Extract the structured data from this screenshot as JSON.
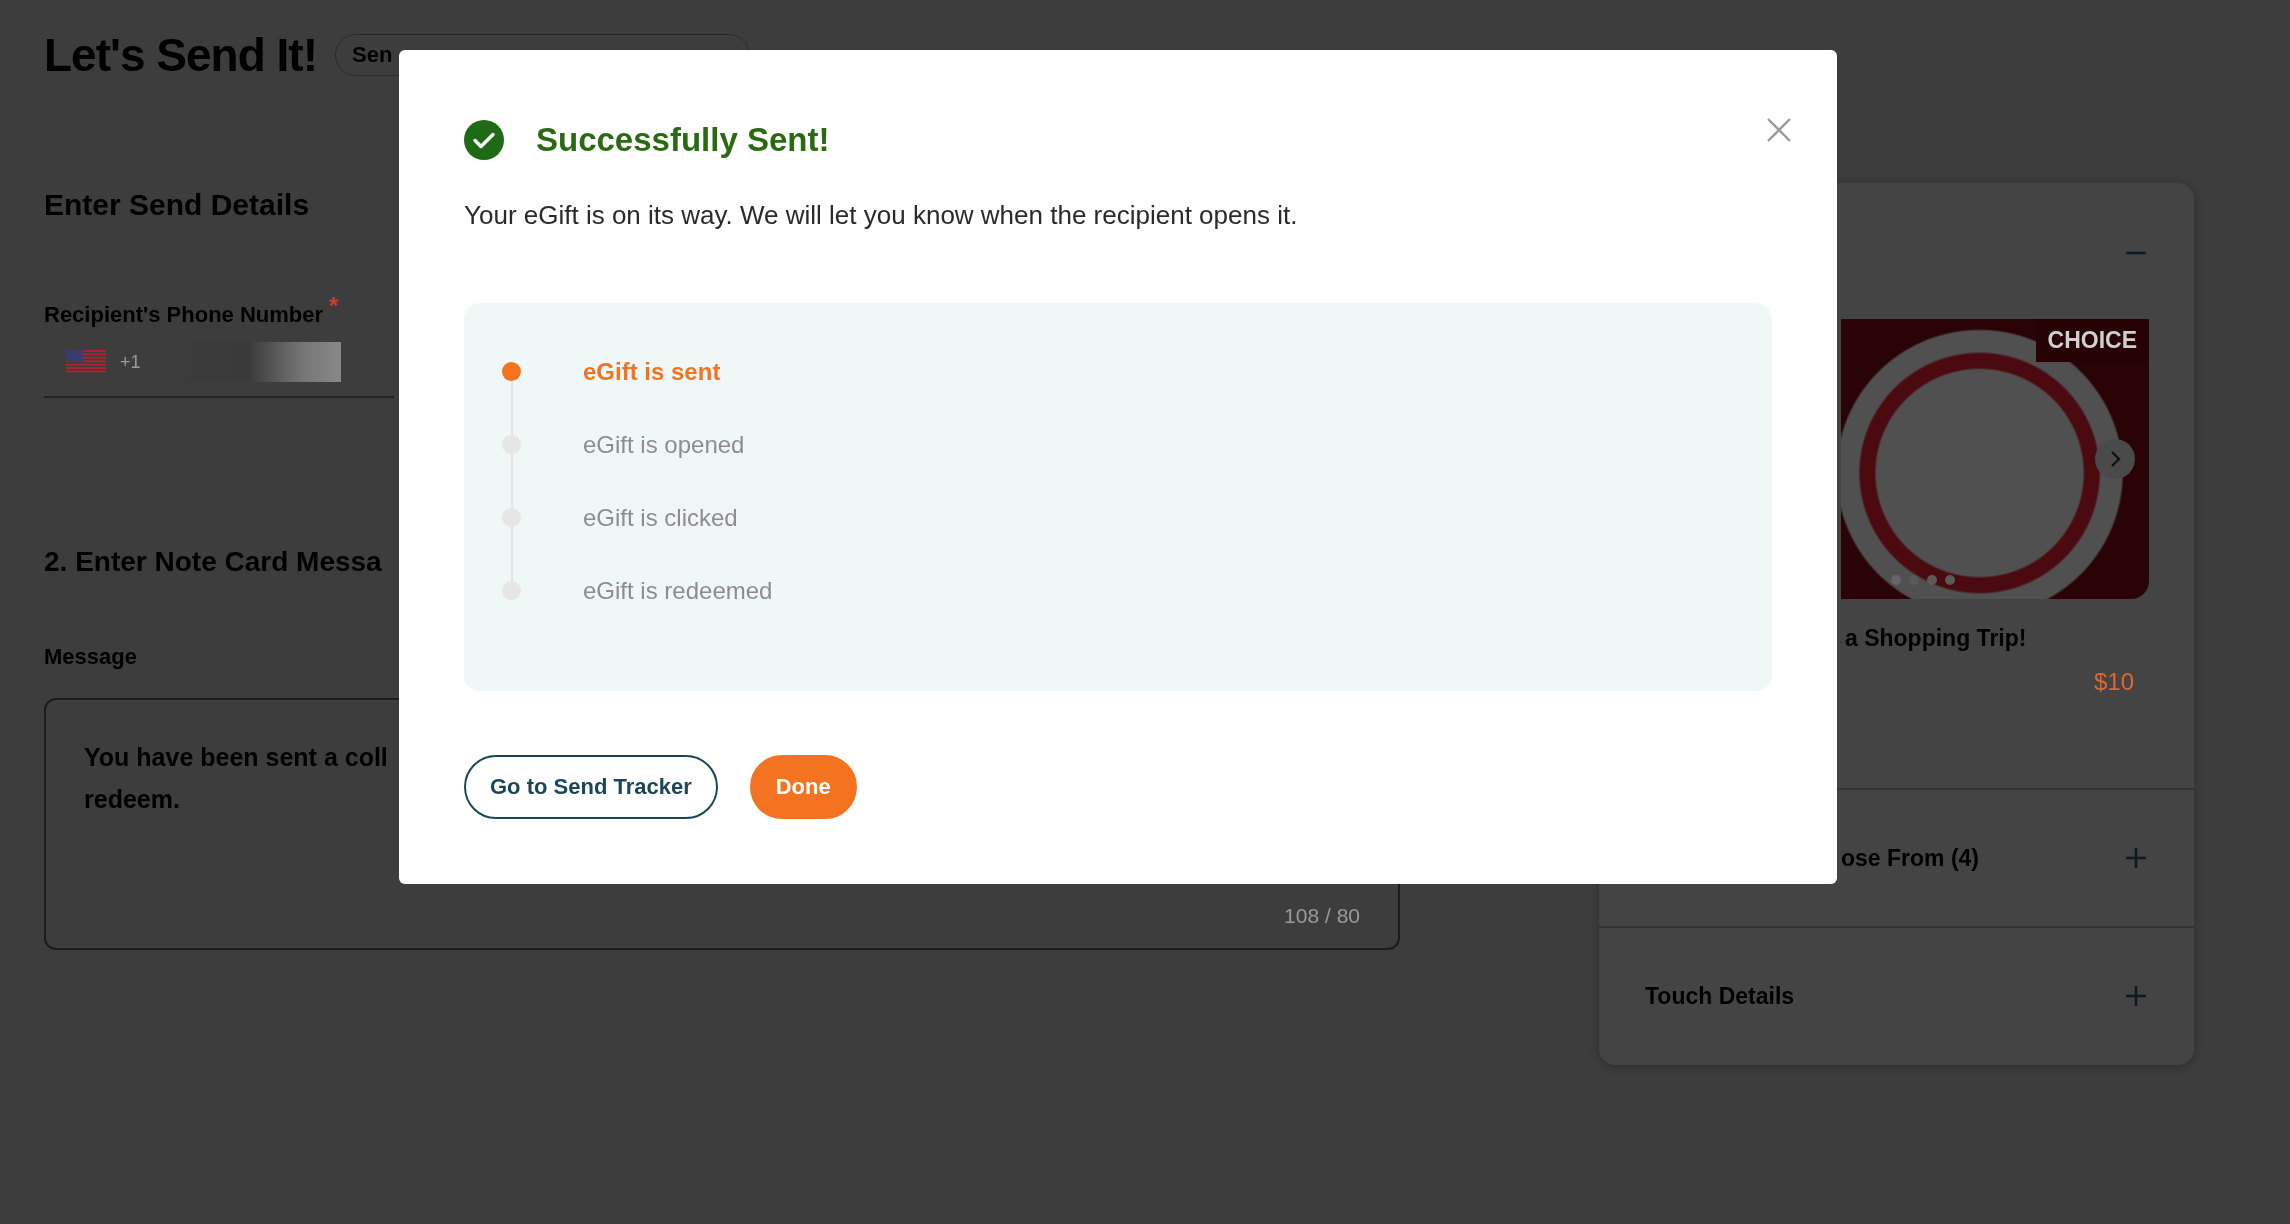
{
  "page": {
    "title": "Let's Send It!",
    "method_pill": "Sen",
    "section_1": "Enter Send Details",
    "phone_label": "Recipient's Phone Number",
    "required_mark": "*",
    "dial_code": "+1",
    "section_2": "2. Enter Note Card Messa",
    "message_label": "Message",
    "message_lines": [
      "You have been sent a coll",
      "redeem."
    ],
    "char_count": "108 / 80"
  },
  "gift_panel": {
    "badge": "CHOICE",
    "gift_title": "a Shopping Trip!",
    "price": "$10",
    "sections": [
      {
        "label": "ose From (4)",
        "expanded": false
      },
      {
        "label": "Touch Details",
        "expanded": false
      }
    ],
    "expanded": true
  },
  "dialog": {
    "title": "Successfully Sent!",
    "message": "Your eGift is on its way. We will let you know when the recipient opens it.",
    "steps": [
      {
        "label": "eGift is sent",
        "done": true
      },
      {
        "label": "eGift is opened",
        "done": false
      },
      {
        "label": "eGift is clicked",
        "done": false
      },
      {
        "label": "eGift is redeemed",
        "done": false
      }
    ],
    "buttons": [
      {
        "label": "Go to Send Tracker",
        "kind": "outline"
      },
      {
        "label": "Done",
        "kind": "primary"
      }
    ]
  }
}
